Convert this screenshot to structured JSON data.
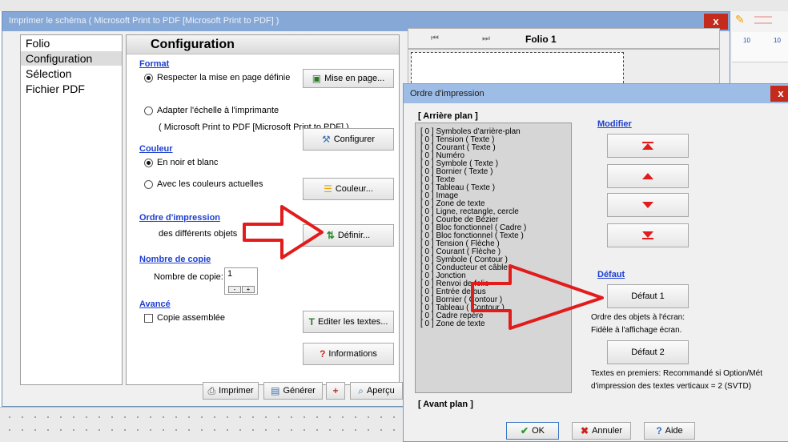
{
  "print_dialog": {
    "title": "Imprimer le schéma ( Microsoft Print to PDF [Microsoft Print to PDF] )",
    "close_label": "x",
    "sidebar": [
      "Folio",
      "Configuration",
      "Sélection",
      "Fichier PDF"
    ],
    "selected_sidebar": "Configuration",
    "panel_title": "Configuration",
    "format": {
      "heading": "Format",
      "radio1": "Respecter la mise en page définie",
      "radio2": "Adapter l'échelle à l'imprimante",
      "printer_note": "( Microsoft Print to PDF [Microsoft Print to PDF] )",
      "mise_en_page_btn": "Mise en page...",
      "configurer_btn": "Configurer"
    },
    "couleur": {
      "heading": "Couleur",
      "radio1": "En noir et blanc",
      "radio2": "Avec les couleurs actuelles",
      "couleur_btn": "Couleur..."
    },
    "ordre": {
      "heading": "Ordre d'impression",
      "desc": "des différents objets",
      "definir_btn": "Définir..."
    },
    "copies": {
      "heading": "Nombre de copie",
      "label": "Nombre de copie:",
      "value": "1",
      "minus": "-",
      "plus": "+"
    },
    "avance": {
      "heading": "Avancé",
      "checkbox": "Copie assemblée",
      "editer_btn": "Editer les textes...",
      "informations_btn": "Informations"
    },
    "bottom": {
      "imprimer": "Imprimer",
      "generer": "Générer",
      "apercu": "Aperçu"
    }
  },
  "preview": {
    "folio_label": "Folio 1",
    "nav_first": "⏮",
    "nav_last": "⏭"
  },
  "order_dialog": {
    "title": "Ordre d'impression",
    "close_label": "x",
    "arriere_plan": "[ Arrière plan ]",
    "avant_plan": "[ Avant plan ]",
    "items": [
      "[ 0 ] Symboles d'arrière-plan",
      "[ 0 ] Tension ( Texte )",
      "[ 0 ] Courant ( Texte )",
      "[ 0 ] Numéro",
      "[ 0 ] Symbole ( Texte )",
      "[ 0 ] Bornier ( Texte )",
      "[ 0 ] Texte",
      "[ 0 ] Tableau ( Texte )",
      "[ 0 ] Image",
      "[ 0 ] Zone de texte",
      "[ 0 ] Ligne, rectangle, cercle",
      "[ 0 ] Courbe de Bézier",
      "[ 0 ] Bloc fonctionnel ( Cadre )",
      "[ 0 ] Bloc fonctionnel ( Texte )",
      "[ 0 ] Tension ( Flèche )",
      "[ 0 ] Courant ( Flèche )",
      "[ 0 ] Symbole ( Contour )",
      "[ 0 ] Conducteur et câble",
      "[ 0 ] Jonction",
      "[ 0 ] Renvoi de folio",
      "[ 0 ] Entrée de bus",
      "[ 0 ] Bornier ( Contour )",
      "[ 0 ] Tableau ( Contour )",
      "[ 0 ] Cadre repère",
      "[ 0 ] Zone de texte"
    ],
    "modifier": "Modifier",
    "defaut": "Défaut",
    "defaut1_btn": "Défaut 1",
    "defaut1_desc1": "Ordre des objets à l'écran:",
    "defaut1_desc2": "Fidèle à l'affichage écran.",
    "defaut2_btn": "Défaut 2",
    "defaut2_desc1": "Textes en premiers: Recommandé si Option/Mét",
    "defaut2_desc2": "d'impression des textes verticaux = 2 (SVTD)",
    "ok": "OK",
    "annuler": "Annuler",
    "aide": "Aide"
  },
  "background": {
    "ruler_labels": [
      "10",
      "10"
    ]
  },
  "colors": {
    "accent_red": "#e21b1b",
    "link_blue": "#1d3fd0",
    "title_blue": "#86a8d6"
  }
}
